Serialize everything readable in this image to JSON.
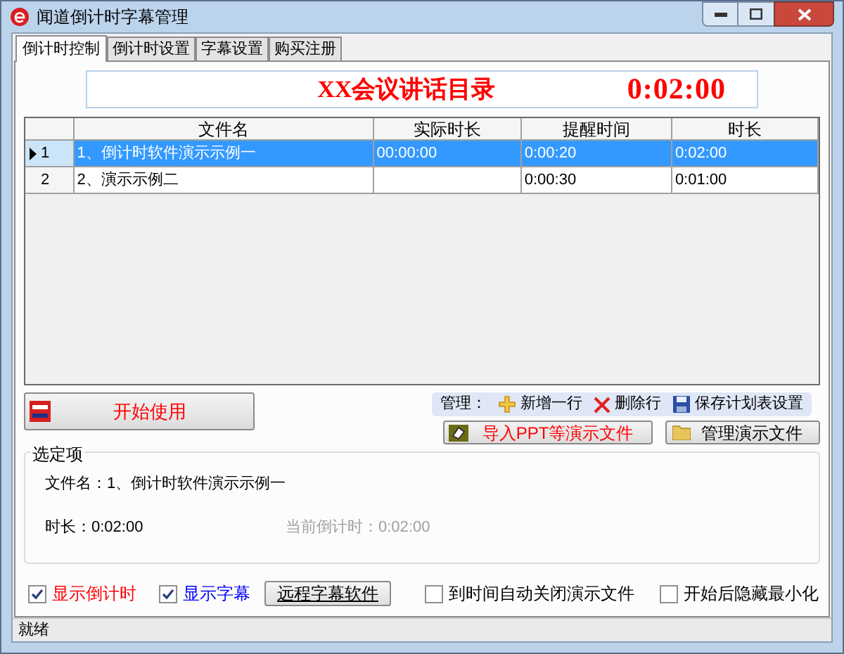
{
  "window": {
    "title": "闻道倒计时字幕管理"
  },
  "tabs": [
    {
      "label": "倒计时控制",
      "selected": true
    },
    {
      "label": "倒计时设置",
      "selected": false
    },
    {
      "label": "字幕设置",
      "selected": false
    },
    {
      "label": "购买注册",
      "selected": false
    }
  ],
  "header": {
    "title": "XX会议讲话目录",
    "timer": "0:02:00"
  },
  "table": {
    "columns": [
      "文件名",
      "实际时长",
      "提醒时间",
      "时长"
    ],
    "rows": [
      {
        "number": "1",
        "selected": true,
        "cells": [
          "1、倒计时软件演示示例一",
          "00:00:00",
          "0:00:20",
          "0:02:00"
        ]
      },
      {
        "number": "2",
        "selected": false,
        "cells": [
          "2、演示示例二",
          "",
          "0:00:30",
          "0:01:00"
        ]
      }
    ]
  },
  "start_button": {
    "label": "开始使用"
  },
  "toolbar": {
    "label": "管理：",
    "buttons": [
      {
        "kind": "add",
        "label": "新增一行"
      },
      {
        "kind": "delete",
        "label": "删除行"
      },
      {
        "kind": "save",
        "label": "保存计划表设置"
      }
    ]
  },
  "import_button": {
    "label": "导入PPT等演示文件"
  },
  "manage_button": {
    "label": "管理演示文件"
  },
  "selection_group": {
    "title": "选定项",
    "file_name": "文件名：1、倒计时软件演示示例一",
    "duration": "时长：0:02:00",
    "current": {
      "text": "当前倒计时：0:02:00",
      "disabled": true
    }
  },
  "options": [
    {
      "kind": "checkbox",
      "label": "显示倒计时",
      "checked": true,
      "color": "#ff0000"
    },
    {
      "kind": "checkbox",
      "label": "显示字幕",
      "checked": true,
      "color": "#0000ff"
    },
    {
      "kind": "button",
      "label": "远程字幕软件"
    },
    {
      "kind": "checkbox",
      "label": "到时间自动关闭演示文件",
      "checked": false,
      "color": "#000000"
    },
    {
      "kind": "checkbox",
      "label": "开始后隐藏最小化",
      "checked": false,
      "color": "#000000"
    }
  ],
  "status_bar": {
    "text": "就绪"
  }
}
